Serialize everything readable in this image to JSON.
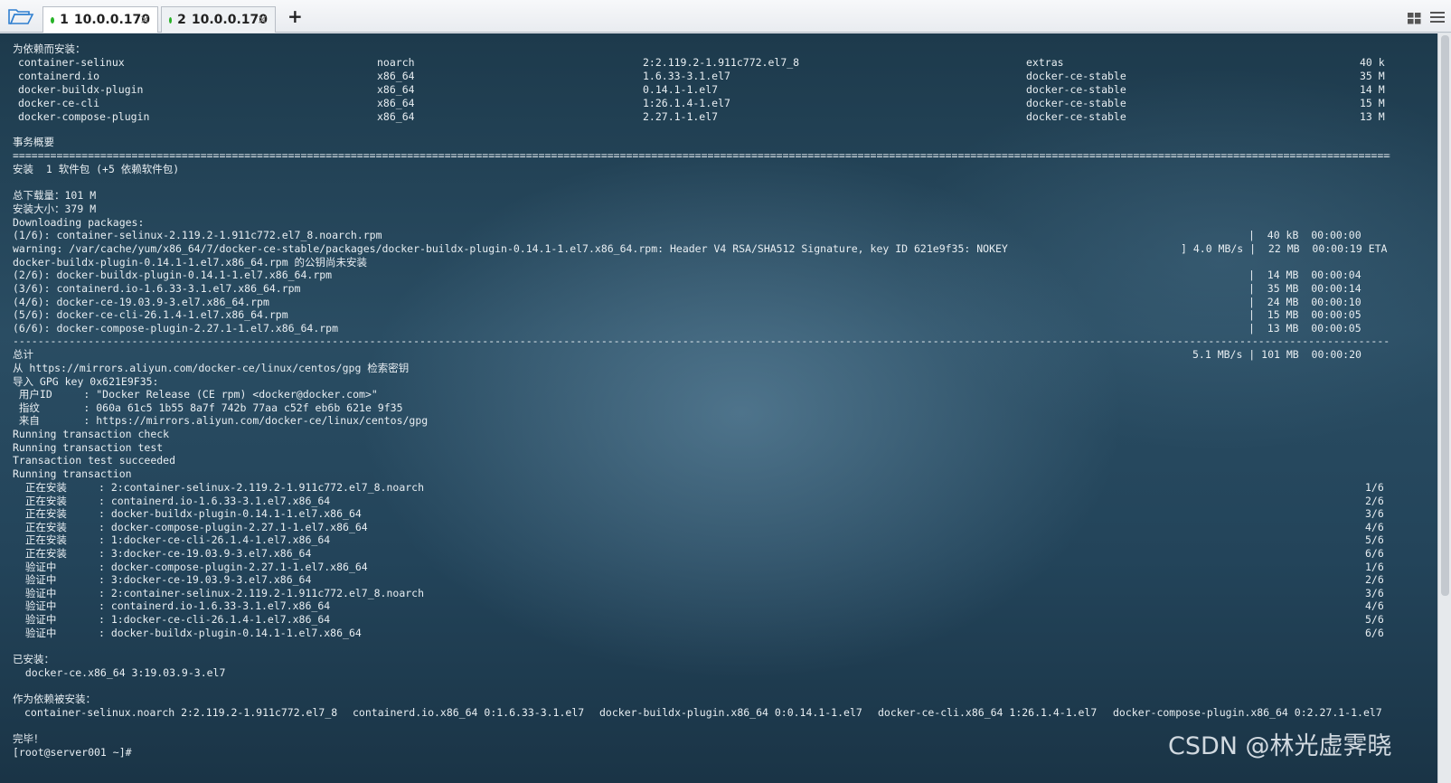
{
  "toolbar": {
    "open_icon": "folder-open-icon"
  },
  "tabs": [
    {
      "number": "1",
      "host": "10.0.0.170",
      "status_color": "#27b327"
    },
    {
      "number": "2",
      "host": "10.0.0.170",
      "status_color": "#27b327"
    }
  ],
  "tab_close": "×",
  "new_tab": "+",
  "terminal": {
    "deps_header": "为依赖而安装：",
    "deps": [
      {
        "pkg": "container-selinux",
        "arch": "noarch",
        "ver": "2:2.119.2-1.911c772.el7_8",
        "repo": "extras",
        "size": "40 k"
      },
      {
        "pkg": "containerd.io",
        "arch": "x86_64",
        "ver": "1.6.33-3.1.el7",
        "repo": "docker-ce-stable",
        "size": "35 M"
      },
      {
        "pkg": "docker-buildx-plugin",
        "arch": "x86_64",
        "ver": "0.14.1-1.el7",
        "repo": "docker-ce-stable",
        "size": "14 M"
      },
      {
        "pkg": "docker-ce-cli",
        "arch": "x86_64",
        "ver": "1:26.1.4-1.el7",
        "repo": "docker-ce-stable",
        "size": "15 M"
      },
      {
        "pkg": "docker-compose-plugin",
        "arch": "x86_64",
        "ver": "2.27.1-1.el7",
        "repo": "docker-ce-stable",
        "size": "13 M"
      }
    ],
    "summary_header": "事务概要",
    "install_summary": "安装  1 软件包 (+5 依赖软件包)",
    "total_download": "总下载量：101 M",
    "install_size": "安装大小：379 M",
    "downloading": "Downloading packages:",
    "dl1": "(1/6): container-selinux-2.119.2-1.911c772.el7_8.noarch.rpm",
    "dl1_stats": "|  40 kB  00:00:00",
    "warning": "warning: /var/cache/yum/x86_64/7/docker-ce-stable/packages/docker-buildx-plugin-0.14.1-1.el7.x86_64.rpm: Header V4 RSA/SHA512 Signature, key ID 621e9f35: NOKEY",
    "warning_stats": "] 4.0 MB/s |  22 MB  00:00:19 ETA",
    "nokey_line": "docker-buildx-plugin-0.14.1-1.el7.x86_64.rpm 的公钥尚未安装",
    "downloads": [
      {
        "name": "(2/6): docker-buildx-plugin-0.14.1-1.el7.x86_64.rpm",
        "stats": "|  14 MB  00:00:04"
      },
      {
        "name": "(3/6): containerd.io-1.6.33-3.1.el7.x86_64.rpm",
        "stats": "|  35 MB  00:00:14"
      },
      {
        "name": "(4/6): docker-ce-19.03.9-3.el7.x86_64.rpm",
        "stats": "|  24 MB  00:00:10"
      },
      {
        "name": "(5/6): docker-ce-cli-26.1.4-1.el7.x86_64.rpm",
        "stats": "|  15 MB  00:00:05"
      },
      {
        "name": "(6/6): docker-compose-plugin-2.27.1-1.el7.x86_64.rpm",
        "stats": "|  13 MB  00:00:05"
      }
    ],
    "total_label": "总计",
    "total_stats": "5.1 MB/s | 101 MB  00:00:20",
    "gpg_lines": [
      "从 https://mirrors.aliyun.com/docker-ce/linux/centos/gpg 检索密钥",
      "导入 GPG key 0x621E9F35:",
      " 用户ID     : \"Docker Release (CE rpm) <docker@docker.com>\"",
      " 指纹       : 060a 61c5 1b55 8a7f 742b 77aa c52f eb6b 621e 9f35",
      " 来自       : https://mirrors.aliyun.com/docker-ce/linux/centos/gpg",
      "Running transaction check",
      "Running transaction test",
      "Transaction test succeeded",
      "Running transaction"
    ],
    "steps": [
      {
        "label": "  正在安装    ",
        "pkg": ": 2:container-selinux-2.119.2-1.911c772.el7_8.noarch",
        "count": "1/6"
      },
      {
        "label": "  正在安装    ",
        "pkg": ": containerd.io-1.6.33-3.1.el7.x86_64",
        "count": "2/6"
      },
      {
        "label": "  正在安装    ",
        "pkg": ": docker-buildx-plugin-0.14.1-1.el7.x86_64",
        "count": "3/6"
      },
      {
        "label": "  正在安装    ",
        "pkg": ": docker-compose-plugin-2.27.1-1.el7.x86_64",
        "count": "4/6"
      },
      {
        "label": "  正在安装    ",
        "pkg": ": 1:docker-ce-cli-26.1.4-1.el7.x86_64",
        "count": "5/6"
      },
      {
        "label": "  正在安装    ",
        "pkg": ": 3:docker-ce-19.03.9-3.el7.x86_64",
        "count": "6/6"
      },
      {
        "label": "  验证中      ",
        "pkg": ": docker-compose-plugin-2.27.1-1.el7.x86_64",
        "count": "1/6"
      },
      {
        "label": "  验证中      ",
        "pkg": ": 3:docker-ce-19.03.9-3.el7.x86_64",
        "count": "2/6"
      },
      {
        "label": "  验证中      ",
        "pkg": ": 2:container-selinux-2.119.2-1.911c772.el7_8.noarch",
        "count": "3/6"
      },
      {
        "label": "  验证中      ",
        "pkg": ": containerd.io-1.6.33-3.1.el7.x86_64",
        "count": "4/6"
      },
      {
        "label": "  验证中      ",
        "pkg": ": 1:docker-ce-cli-26.1.4-1.el7.x86_64",
        "count": "5/6"
      },
      {
        "label": "  验证中      ",
        "pkg": ": docker-buildx-plugin-0.14.1-1.el7.x86_64",
        "count": "6/6"
      }
    ],
    "installed_header": "已安装：",
    "installed_pkg": "  docker-ce.x86_64 3:19.03.9-3.el7",
    "dep_installed_header": "作为依赖被安装：",
    "dep_installed": [
      "container-selinux.noarch 2:2.119.2-1.911c772.el7_8",
      "containerd.io.x86_64 0:1.6.33-3.1.el7",
      "docker-buildx-plugin.x86_64 0:0.14.1-1.el7",
      "docker-ce-cli.x86_64 1:26.1.4-1.el7",
      "docker-compose-plugin.x86_64 0:2.27.1-1.el7"
    ],
    "done": "完毕！",
    "prompt": "[root@server001 ~]#",
    "separator_double": "=",
    "separator_dash": "-"
  },
  "watermark": "CSDN @林光虚霁晓"
}
